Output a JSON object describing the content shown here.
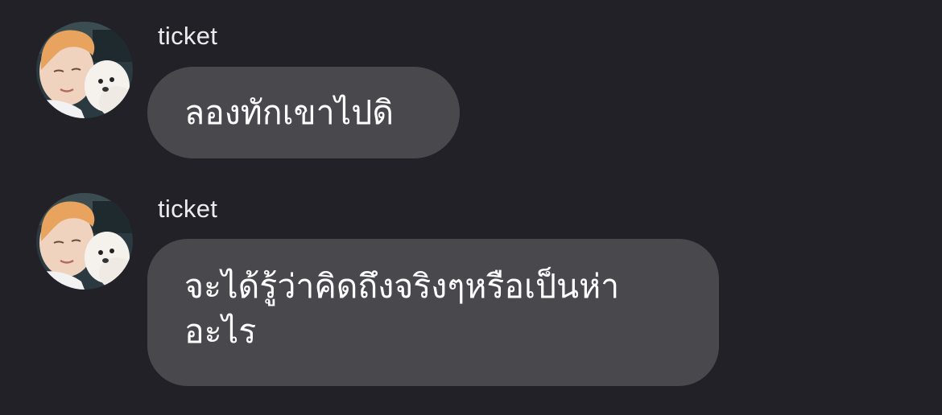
{
  "messages": [
    {
      "sender": "ticket",
      "avatar": "profile-photo-person-with-white-dog",
      "text": "ลองทักเขาไปดิ"
    },
    {
      "sender": "ticket",
      "avatar": "profile-photo-person-with-white-dog",
      "text": "จะได้รู้ว่าคิดถึงจริงๆหรือเป็นห่า\nอะไร"
    }
  ],
  "colors": {
    "background": "#222128",
    "bubble": "#48484d",
    "text": "#ffffff",
    "sender": "#ececef"
  }
}
